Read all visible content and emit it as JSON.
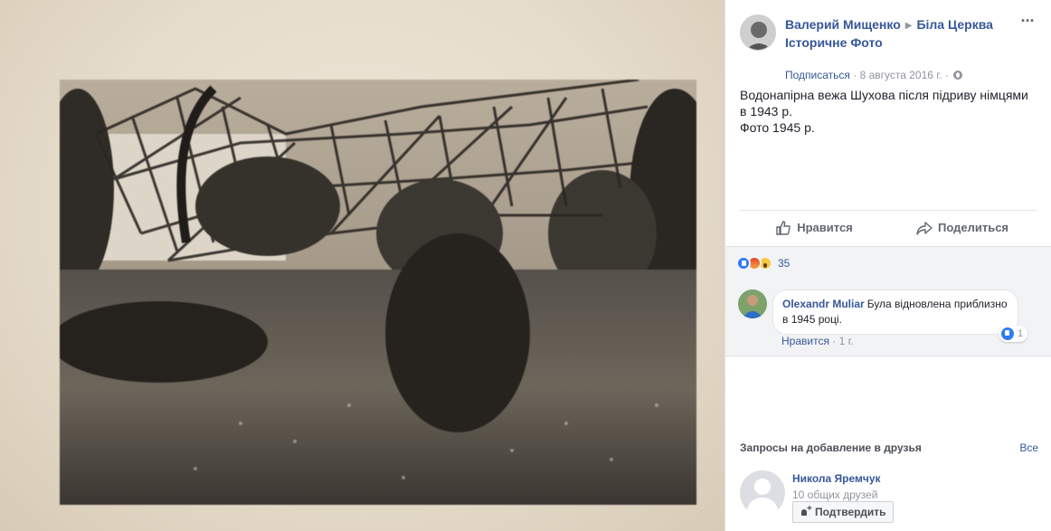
{
  "post": {
    "author": "Валерий Мищенко",
    "group_line1": "Біла Церква",
    "group_line2": "Історичне Фото",
    "subscribe": "Подписаться",
    "date": "8 августа 2016 г.",
    "separator": "·",
    "text_line1": "Водонапірна вежа Шухова після підриву німцями в 1943 р.",
    "text_line2": "Фото 1945 р.",
    "more_icon": "ellipsis-icon",
    "privacy_icon": "globe-icon"
  },
  "actions": {
    "like": "Нравится",
    "share": "Поделиться"
  },
  "reactions": {
    "icons": [
      "like-icon",
      "angry-icon",
      "wow-icon"
    ],
    "count": "35"
  },
  "comment": {
    "author": "Olexandr Muliar",
    "text": "Була відновлена приблизно в 1945 році.",
    "like_link": "Нравится",
    "age": "1 г.",
    "like_count": "1"
  },
  "friends": {
    "title": "Запросы на добавление в друзья",
    "see_all": "Все",
    "request": {
      "name": "Никола Яремчук",
      "mutual": "10 общих друзей",
      "confirm": "Подтвердить"
    }
  },
  "colors": {
    "link": "#365899",
    "muted": "#90949c",
    "like_blue": "#2e7bf4",
    "comment_bg": "#f2f3f5"
  }
}
